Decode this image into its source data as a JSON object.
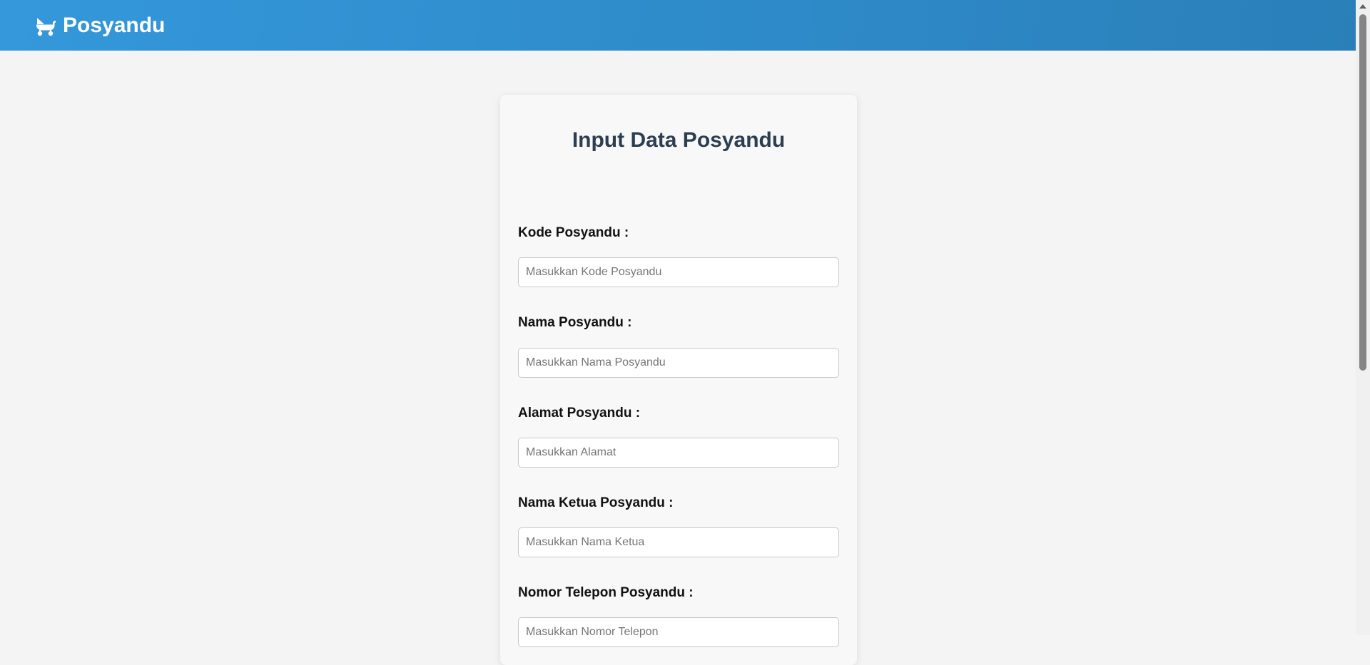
{
  "header": {
    "brand_label": "Posyandu",
    "brand_icon": "baby-carriage-icon",
    "colors": {
      "gradient_start": "#3498db",
      "gradient_end": "#2a7fb8"
    }
  },
  "form": {
    "title": "Input Data Posyandu",
    "fields": [
      {
        "label": "Kode Posyandu :",
        "placeholder": "Masukkan Kode Posyandu",
        "value": ""
      },
      {
        "label": "Nama Posyandu :",
        "placeholder": "Masukkan Nama Posyandu",
        "value": ""
      },
      {
        "label": "Alamat Posyandu :",
        "placeholder": "Masukkan Alamat",
        "value": ""
      },
      {
        "label": "Nama Ketua Posyandu :",
        "placeholder": "Masukkan Nama Ketua",
        "value": ""
      },
      {
        "label": "Nomor Telepon Posyandu :",
        "placeholder": "Masukkan Nomor Telepon",
        "value": ""
      }
    ]
  }
}
